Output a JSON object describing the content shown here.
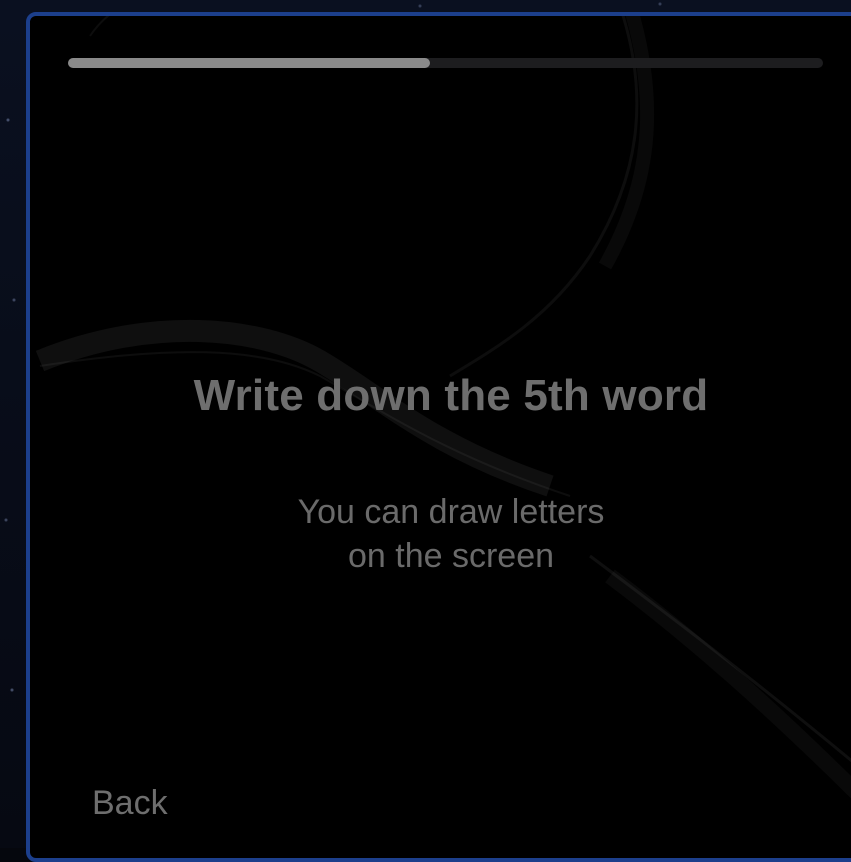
{
  "progress": {
    "value": 0.48
  },
  "prompt": {
    "title": "Write down the 5th word",
    "hint_line1": "You can draw letters",
    "hint_line2": "on the screen"
  },
  "nav": {
    "back_label": "Back"
  },
  "colors": {
    "frame_border": "#1c3f8c",
    "panel_background": "#000000",
    "progress_fill": "#8a8a8a",
    "progress_track": "#1d1d1f",
    "text": "#6e6e6e"
  }
}
